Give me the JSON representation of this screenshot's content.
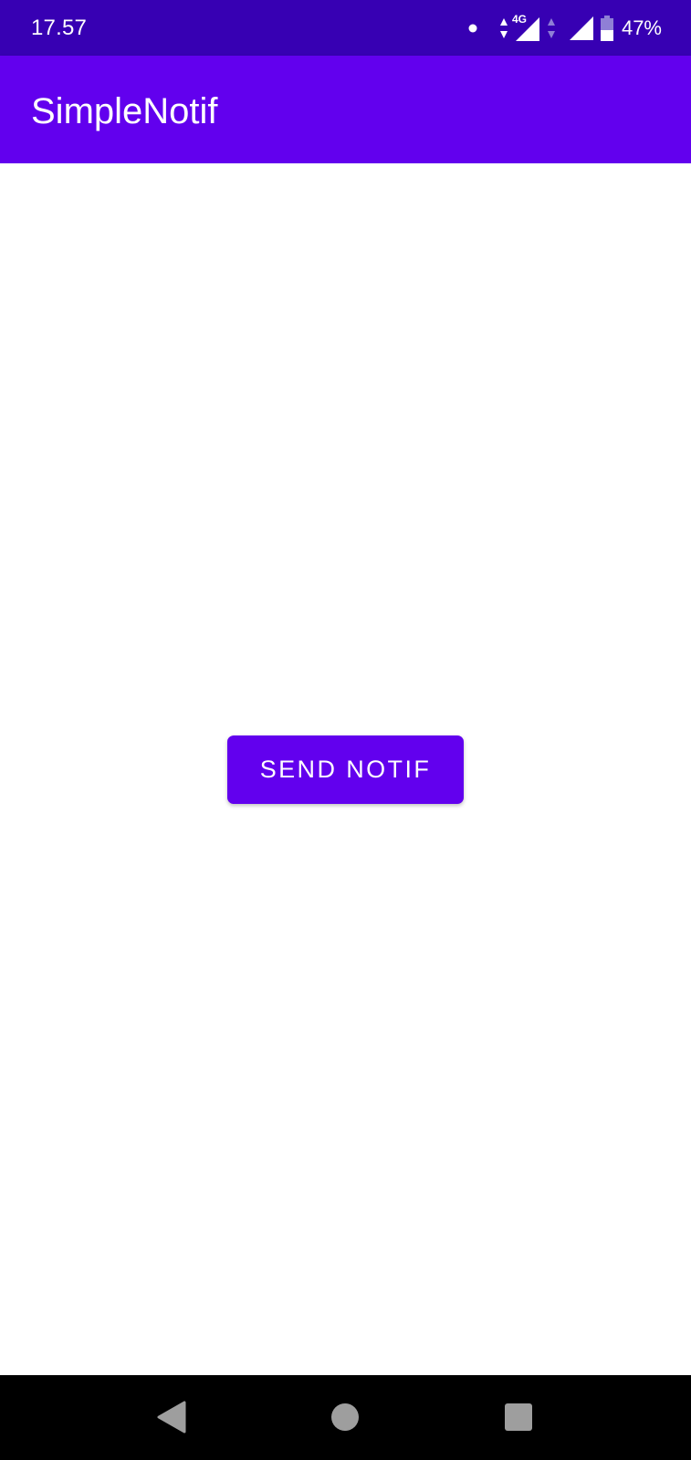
{
  "status_bar": {
    "time": "17.57",
    "network_label": "4G",
    "battery_percent": "47%",
    "battery_level": 0.47,
    "icons": [
      "notification-dot-icon",
      "data-arrows-icon",
      "signal-4g-icon",
      "signal-icon",
      "battery-icon"
    ]
  },
  "app_bar": {
    "title": "SimpleNotif",
    "color": "#6200ee"
  },
  "status_bar_color": "#3700b3",
  "main": {
    "send_button_label": "SEND NOTIF"
  },
  "nav_bar": {
    "icons": [
      "back-icon",
      "home-icon",
      "recents-icon"
    ]
  }
}
